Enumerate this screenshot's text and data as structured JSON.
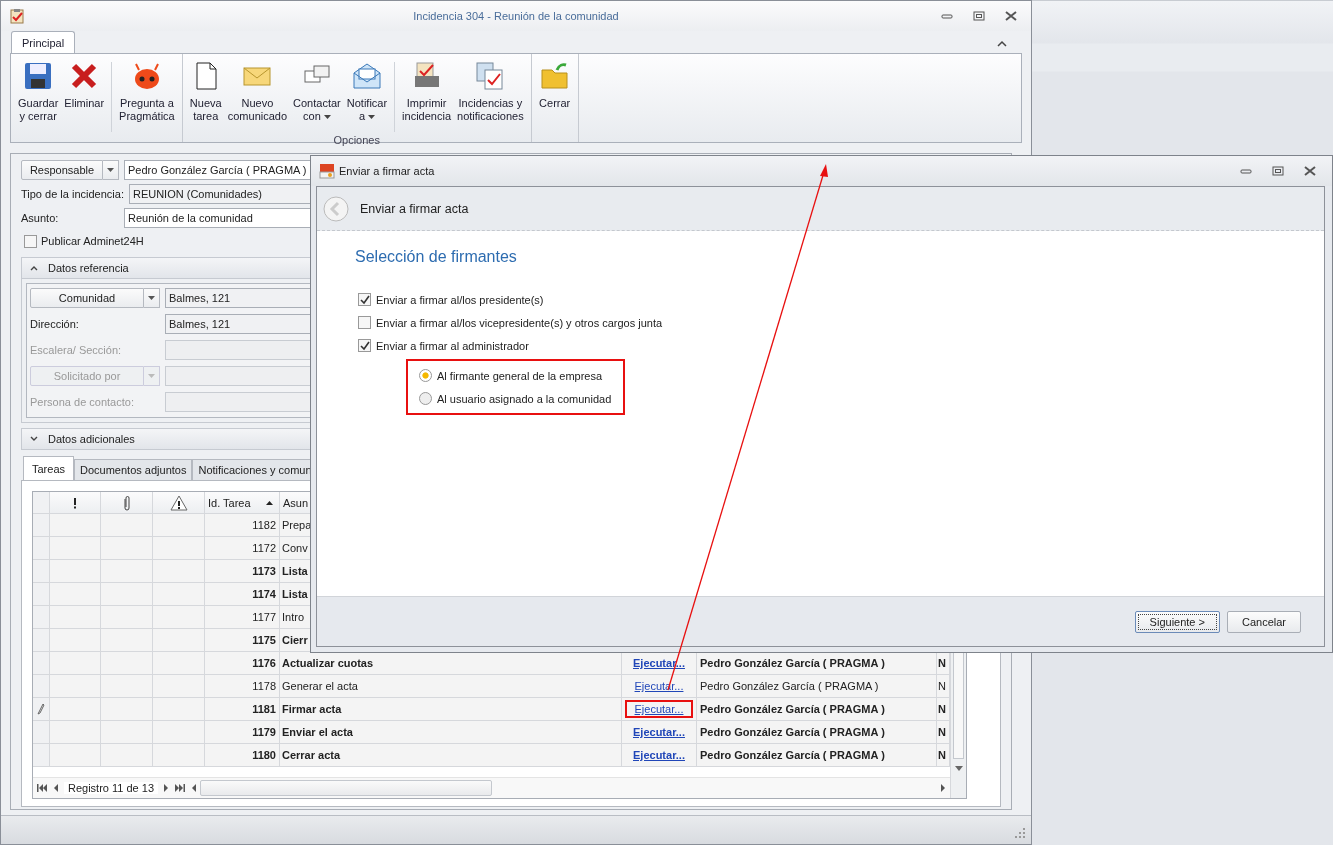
{
  "window": {
    "title": "Incidencia 304 - Reunión de la comunidad"
  },
  "ribbon": {
    "tabs": [
      {
        "label": "Principal",
        "selected": true
      }
    ],
    "groups": [
      {
        "buttons": [
          {
            "kind": "save",
            "lines": [
              "Guardar",
              "y cerrar"
            ]
          },
          {
            "kind": "delete",
            "lines": [
              "Eliminar"
            ],
            "separator_after": true
          },
          {
            "kind": "robot",
            "lines": [
              "Pregunta a",
              "Pragmática"
            ]
          }
        ]
      },
      {
        "label": "Opciones",
        "buttons": [
          {
            "kind": "document",
            "lines": [
              "Nueva",
              "tarea"
            ]
          },
          {
            "kind": "envelope",
            "lines": [
              "Nuevo",
              "comunicado"
            ]
          },
          {
            "kind": "chat",
            "lines": [
              "Contactar",
              "con"
            ],
            "dropdown": true
          },
          {
            "kind": "mail",
            "lines": [
              "Notificar",
              "a"
            ],
            "dropdown": true,
            "separator_after": true
          },
          {
            "kind": "printer",
            "lines": [
              "Imprimir",
              "incidencia"
            ]
          },
          {
            "kind": "clipboard",
            "lines": [
              "Incidencias y",
              "notificaciones"
            ]
          }
        ]
      },
      {
        "buttons": [
          {
            "kind": "folder",
            "lines": [
              "Cerrar"
            ]
          }
        ]
      }
    ]
  },
  "form": {
    "responsable": {
      "button": "Responsable",
      "value": "Pedro González García ( PRAGMA )"
    },
    "fields": [
      {
        "label": "Tipo de la incidencia:",
        "value": "REUNION (Comunidades)",
        "readonly": true
      },
      {
        "label": "Asunto:",
        "value": "Reunión de la comunidad",
        "readonly": false
      }
    ],
    "publish": {
      "label": "Publicar Adminet24H",
      "checked": false
    }
  },
  "sections": [
    {
      "title": "Datos referencia",
      "expanded": true,
      "rows": [
        {
          "kind": "combo",
          "button": "Comunidad",
          "value": "Balmes, 121",
          "disabled": false
        },
        {
          "kind": "field",
          "label": "Dirección:",
          "value": "Balmes, 121",
          "disabled": false
        },
        {
          "kind": "field",
          "label": "Escalera/ Sección:",
          "disabled": true
        },
        {
          "kind": "combo",
          "button": "Solicitado por",
          "disabled": true
        },
        {
          "kind": "field",
          "label": "Persona de contacto:",
          "disabled": true
        }
      ]
    },
    {
      "title": "Datos adicionales",
      "expanded": false
    }
  ],
  "tabs": [
    {
      "label": "Tareas",
      "selected": true
    },
    {
      "label": "Documentos adjuntos",
      "selected": false
    },
    {
      "label": "Notificaciones y comun",
      "selected": false
    }
  ],
  "table": {
    "columns": [
      {
        "kind": "priority"
      },
      {
        "kind": "attachment"
      },
      {
        "kind": "warning"
      },
      {
        "kind": "text",
        "label": "Id. Tarea",
        "sorted": true
      },
      {
        "kind": "text",
        "label": "Asun"
      }
    ],
    "rows": [
      {
        "id": "1182",
        "subject": "Prepa",
        "bold": false,
        "selected": false
      },
      {
        "id": "1172",
        "subject": "Conv",
        "bold": false,
        "selected": false
      },
      {
        "id": "1173",
        "subject": "Lista",
        "bold": true,
        "selected": false
      },
      {
        "id": "1174",
        "subject": "Lista",
        "bold": true,
        "selected": false
      },
      {
        "id": "1177",
        "subject": "Intro",
        "bold": false,
        "selected": false
      },
      {
        "id": "1175",
        "subject": "Cierr",
        "bold": true,
        "selected": false
      },
      {
        "id": "1176",
        "subject": "Actualizar cuotas",
        "action": "Ejecutar...",
        "owner": "Pedro González García ( PRAGMA )",
        "column_9": "N",
        "bold": true,
        "selected": false
      },
      {
        "id": "1178",
        "subject": "Generar el acta",
        "action": "Ejecutar...",
        "owner": "Pedro González García ( PRAGMA )",
        "column_9": "N",
        "bold": false,
        "selected": false
      },
      {
        "id": "1181",
        "subject": "Firmar acta",
        "action": "Ejecutar...",
        "owner": "Pedro González García ( PRAGMA )",
        "column_9": "N",
        "bold": true,
        "selected": true
      },
      {
        "id": "1179",
        "subject": "Enviar el acta",
        "action": "Ejecutar...",
        "owner": "Pedro González García ( PRAGMA )",
        "column_9": "N",
        "bold": true,
        "selected": false
      },
      {
        "id": "1180",
        "subject": "Cerrar acta",
        "action": "Ejecutar...",
        "owner": "Pedro González García ( PRAGMA )",
        "column_9": "N",
        "bold": true,
        "selected": false
      }
    ],
    "pager": "Registro 11 de 13"
  },
  "dialog": {
    "title": "Enviar a firmar acta",
    "header": "Enviar a firmar acta",
    "heading": "Selección de firmantes",
    "options": [
      {
        "label": "Enviar a firmar al/los presidente(s)",
        "checked": true
      },
      {
        "label": "Enviar a firmar al/los vicepresidente(s) y otros cargos junta",
        "checked": false
      },
      {
        "label": "Enviar a firmar al administrador",
        "checked": true
      }
    ],
    "radios": [
      {
        "label": "Al firmante general de la empresa",
        "selected": true
      },
      {
        "label": "Al usuario asignado a la comunidad",
        "selected": false
      }
    ],
    "buttons": [
      {
        "label": "Siguiente >",
        "default": true
      },
      {
        "label": "Cancelar",
        "default": false
      }
    ]
  }
}
